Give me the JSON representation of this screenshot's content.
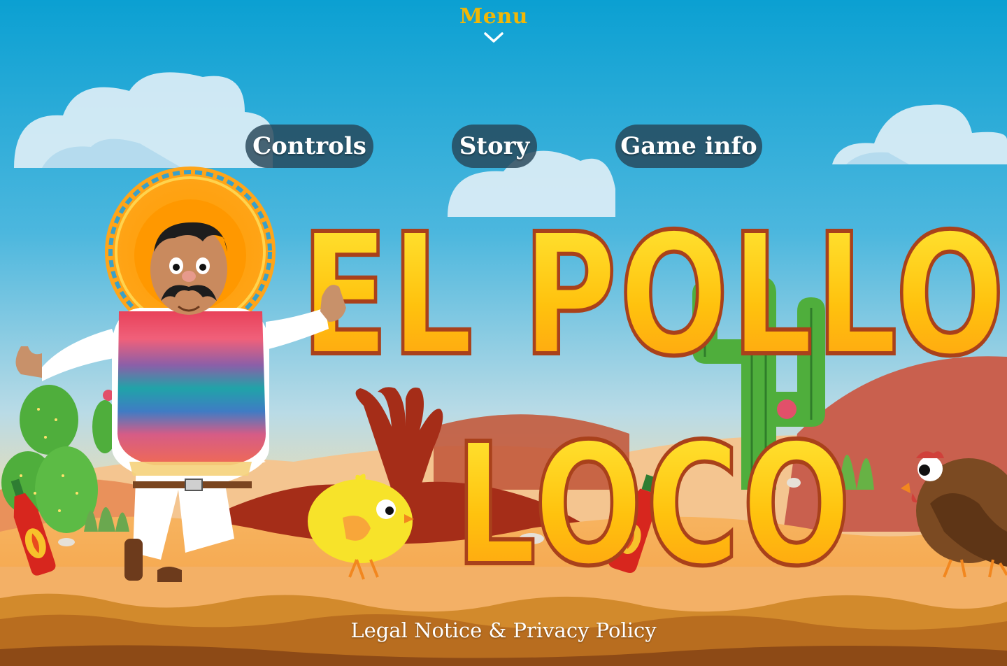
{
  "menu": {
    "label": "Menu",
    "chevron_icon": "chevron-down-icon"
  },
  "nav": {
    "controls": "Controls",
    "story": "Story",
    "game_info": "Game info"
  },
  "title": {
    "line1": "EL POLLO",
    "line2": "LOCO"
  },
  "footer": {
    "legal": "Legal Notice & Privacy Policy"
  },
  "colors": {
    "sky_top": "#0ea0d2",
    "sky_bottom": "#f2d6a0",
    "title_yellow": "#ffd21f",
    "title_outline": "#a9411b",
    "menu_gold": "#f2b705",
    "pill_bg": "#264658"
  }
}
